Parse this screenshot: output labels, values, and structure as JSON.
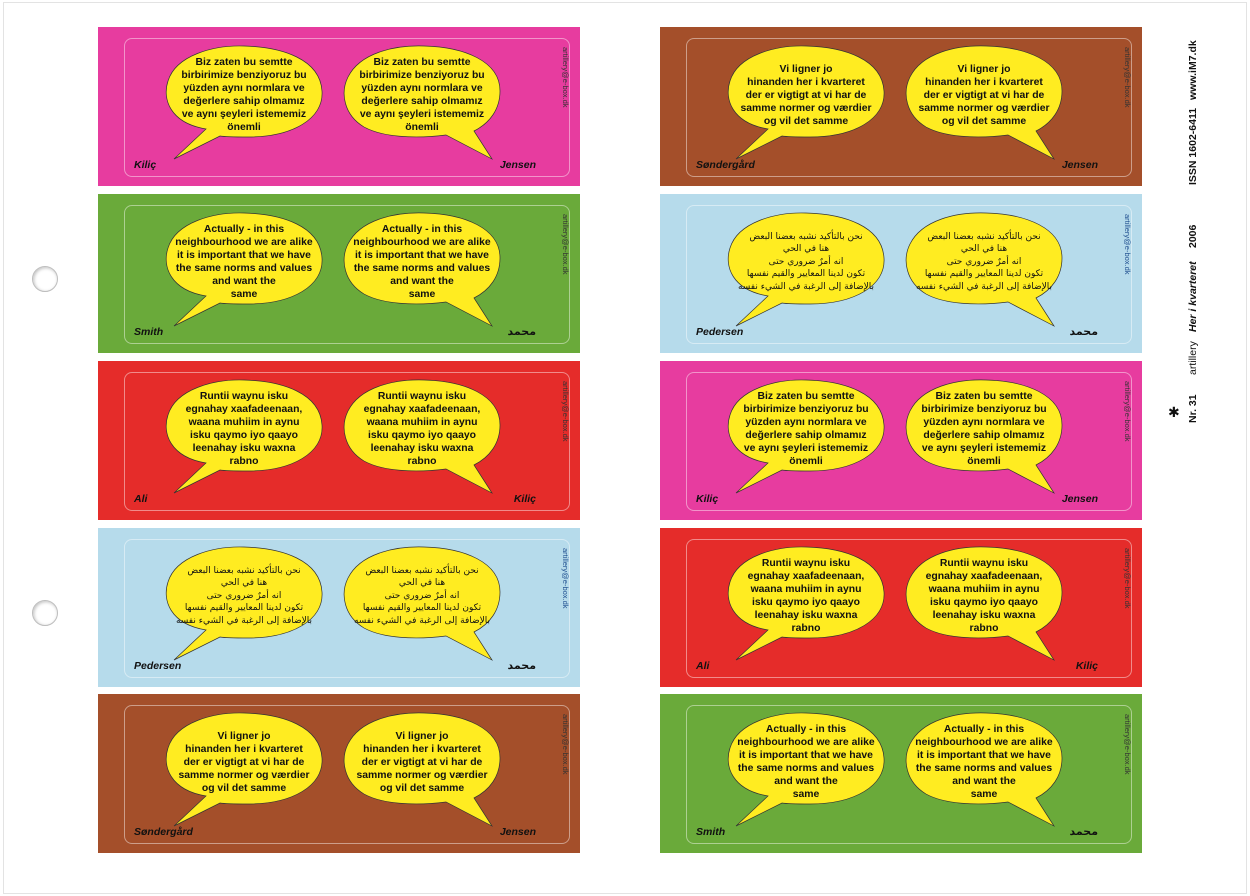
{
  "page": {
    "issn": "ISSN 1602-6411",
    "website": "www.iM7.dk",
    "issue": "Nr. 31",
    "brand": "artillery",
    "title_italic": "Her i kvarteret",
    "year": "2006",
    "star_glyph": "✱"
  },
  "credit_text": "artillery@e-box.dk",
  "colors": {
    "pink": "#e73c9f",
    "green": "#6aaa3a",
    "red": "#e52c2a",
    "lightblue": "#b6dbeb",
    "brown": "#a44f2a",
    "bubble_fill": "#ffec21"
  },
  "texts": {
    "turkish": "Biz zaten bu semtte\nbirbirimize benziyoruz bu\nyüzden aynı normlara ve\ndeğerlere sahip olmamız\nve aynı şeyleri istememiz\nönemli",
    "english": "Actually - in this\nneighbourhood we are alike\nit is important that we have\nthe same norms and values\nand want the\nsame",
    "somali": "Runtii waynu isku\negnahay xaafadeenaan,\nwaana muhiim in aynu\nisku qaymo iyo qaayo\nleenahay isku waxna\nrabno",
    "arabic": "نحن بالتأكيد نشبه بعضنا البعض\nهنا في الحي\nانه أمرٌ ضروري حتى\nتكون لدينا المعايير والقيم نفسها\nبالإضافة إلى الرغبة في الشيء نفسه",
    "danish": "Vi ligner jo\nhinanden her i kvarteret\nder er vigtigt at vi har de\nsamme normer og værdier\nog vil det samme"
  },
  "panels": [
    {
      "color": "pink",
      "text": "turkish",
      "name_left": "Kiliç",
      "name_right": "Jensen"
    },
    {
      "color": "green",
      "text": "english",
      "name_left": "Smith",
      "name_right": "محمد"
    },
    {
      "color": "red",
      "text": "somali",
      "name_left": "Ali",
      "name_right": "Kiliç"
    },
    {
      "color": "lightblue",
      "text": "arabic",
      "name_left": "Pedersen",
      "name_right": "محمد"
    },
    {
      "color": "brown",
      "text": "danish",
      "name_left": "Søndergård",
      "name_right": "Jensen"
    },
    {
      "color": "brown",
      "text": "danish",
      "name_left": "Søndergård",
      "name_right": "Jensen"
    },
    {
      "color": "lightblue",
      "text": "arabic",
      "name_left": "Pedersen",
      "name_right": "محمد"
    },
    {
      "color": "pink",
      "text": "turkish",
      "name_left": "Kiliç",
      "name_right": "Jensen"
    },
    {
      "color": "red",
      "text": "somali",
      "name_left": "Ali",
      "name_right": "Kiliç"
    },
    {
      "color": "green",
      "text": "english",
      "name_left": "Smith",
      "name_right": "محمد"
    }
  ]
}
